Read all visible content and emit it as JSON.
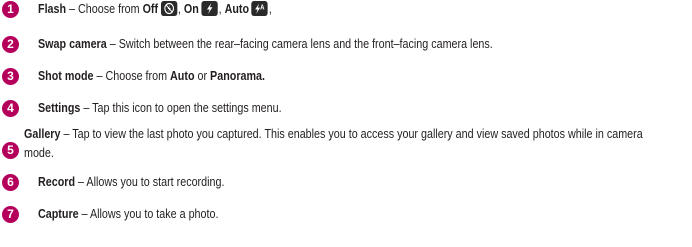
{
  "items": [
    {
      "number": "1",
      "title": "Flash",
      "dash": " – ",
      "lead": "Choose from ",
      "opt1": "Off",
      "opt2": "On",
      "opt3": "Auto",
      "sep": ",",
      "icons": [
        "flash-off-icon",
        "flash-on-icon",
        "flash-auto-icon"
      ]
    },
    {
      "number": "2",
      "title": "Swap camera",
      "dash": " – ",
      "desc": "Switch between the rear–facing camera lens and the front–facing camera lens."
    },
    {
      "number": "3",
      "title": "Shot mode",
      "dash": " – ",
      "lead": "Choose from ",
      "opt1": "Auto",
      "mid": " or ",
      "opt2": "Panorama."
    },
    {
      "number": "4",
      "title": "Settings",
      "dash": " – ",
      "desc": "Tap this icon to open the settings menu."
    },
    {
      "number": "5",
      "title": "Gallery",
      "dash": " – ",
      "desc": "Tap to view the last photo you captured. This enables you to access your gallery and view saved photos while in camera mode."
    },
    {
      "number": "6",
      "title": "Record",
      "dash": " – ",
      "desc": "Allows you to start recording."
    },
    {
      "number": "7",
      "title": "Capture",
      "dash": " – ",
      "desc": "Allows you to take a photo."
    }
  ],
  "colors": {
    "accent": "#b5005b",
    "text": "#231f20",
    "icon_bg": "#2a2a2a"
  }
}
